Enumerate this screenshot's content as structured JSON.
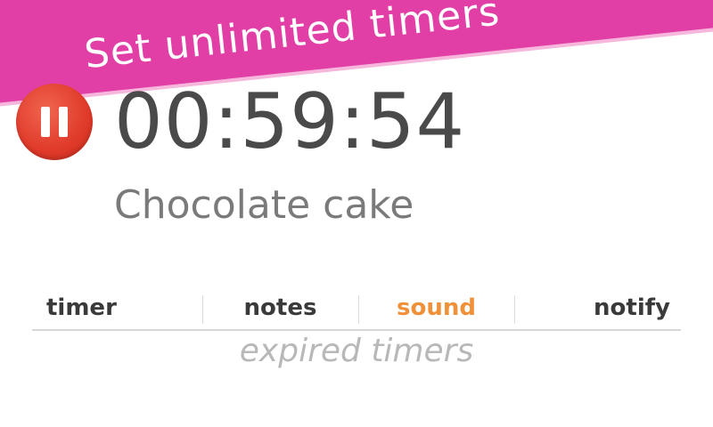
{
  "banner": {
    "text": "Set unlimited timers",
    "color": "#e23fa6"
  },
  "timer": {
    "time": "00:59:54",
    "name": "Chocolate cake",
    "state_icon": "pause-icon",
    "button_color": "#e03a2a"
  },
  "tabs": [
    {
      "label": "timer",
      "active": false
    },
    {
      "label": "notes",
      "active": false
    },
    {
      "label": "sound",
      "active": true
    },
    {
      "label": "notify",
      "active": false
    }
  ],
  "accent_color": "#f0913a",
  "expired_label": "expired timers"
}
